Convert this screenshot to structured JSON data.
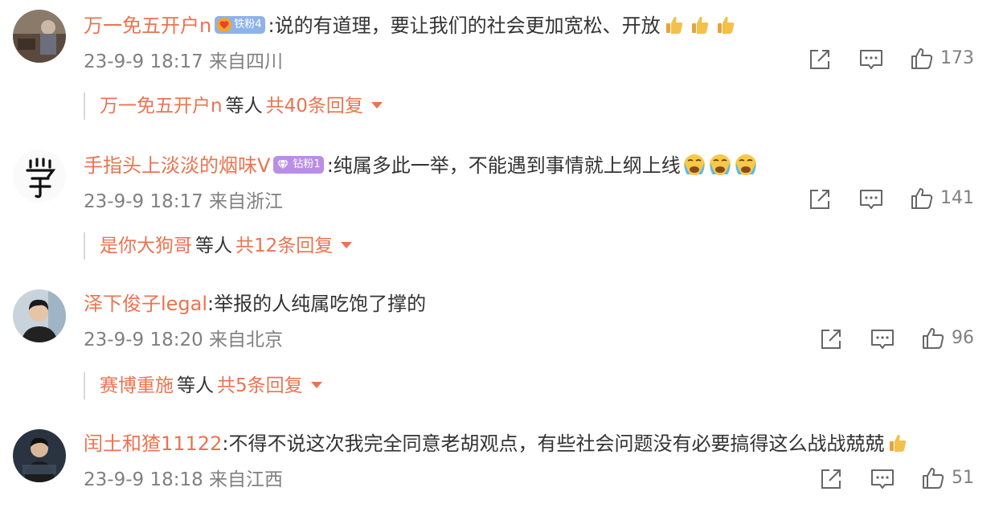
{
  "comments": [
    {
      "username": "万一免五开户n",
      "badge": {
        "label": "铁粉4",
        "color": "#8fb3e8",
        "icon": "heart-icon"
      },
      "text": ":说的有道理，要让我们的社会更加宽松、开放",
      "emojis": [
        "thumbs-up-emoji",
        "thumbs-up-emoji",
        "thumbs-up-emoji"
      ],
      "time": "23-9-9 18:17",
      "location": "来自四川",
      "likes": "173",
      "reply": {
        "users": "万一免五开户n",
        "etc": "等人",
        "count": "共40条回复"
      }
    },
    {
      "username": "手指头上淡淡的烟味V",
      "badge": {
        "label": "钻粉1",
        "color": "#b98ee6",
        "icon": "diamond-icon"
      },
      "text": ":纯属多此一举，不能遇到事情就上纲上线",
      "emojis": [
        "crying-emoji",
        "crying-emoji",
        "crying-emoji"
      ],
      "time": "23-9-9 18:17",
      "location": "来自浙江",
      "likes": "141",
      "reply": {
        "users": "是你大狗哥",
        "etc": "等人",
        "count": "共12条回复"
      }
    },
    {
      "username": "泽下俊子legal",
      "text": ":举报的人纯属吃饱了撑的",
      "time": "23-9-9 18:20",
      "location": "来自北京",
      "likes": "96",
      "reply": {
        "users": "赛博重施",
        "etc": "等人",
        "count": "共5条回复"
      }
    },
    {
      "username": "闰土和猹11122",
      "text": ":不得不说这次我完全同意老胡观点，有些社会问题没有必要搞得这么战战兢兢",
      "emojis": [
        "thumbs-up-emoji"
      ],
      "time": "23-9-9 18:18",
      "location": "来自江西",
      "likes": "51"
    }
  ],
  "colors": {
    "accent": "#eb7350",
    "meta": "#808080",
    "icon": "#666666"
  }
}
